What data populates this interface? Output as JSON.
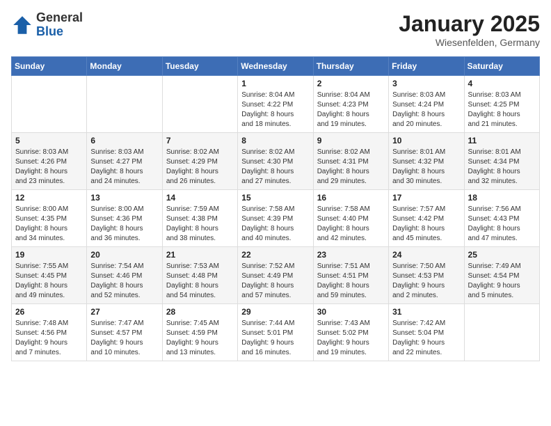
{
  "header": {
    "logo_general": "General",
    "logo_blue": "Blue",
    "month_title": "January 2025",
    "location": "Wiesenfelden, Germany"
  },
  "weekdays": [
    "Sunday",
    "Monday",
    "Tuesday",
    "Wednesday",
    "Thursday",
    "Friday",
    "Saturday"
  ],
  "weeks": [
    [
      {
        "day": "",
        "info": ""
      },
      {
        "day": "",
        "info": ""
      },
      {
        "day": "",
        "info": ""
      },
      {
        "day": "1",
        "info": "Sunrise: 8:04 AM\nSunset: 4:22 PM\nDaylight: 8 hours\nand 18 minutes."
      },
      {
        "day": "2",
        "info": "Sunrise: 8:04 AM\nSunset: 4:23 PM\nDaylight: 8 hours\nand 19 minutes."
      },
      {
        "day": "3",
        "info": "Sunrise: 8:03 AM\nSunset: 4:24 PM\nDaylight: 8 hours\nand 20 minutes."
      },
      {
        "day": "4",
        "info": "Sunrise: 8:03 AM\nSunset: 4:25 PM\nDaylight: 8 hours\nand 21 minutes."
      }
    ],
    [
      {
        "day": "5",
        "info": "Sunrise: 8:03 AM\nSunset: 4:26 PM\nDaylight: 8 hours\nand 23 minutes."
      },
      {
        "day": "6",
        "info": "Sunrise: 8:03 AM\nSunset: 4:27 PM\nDaylight: 8 hours\nand 24 minutes."
      },
      {
        "day": "7",
        "info": "Sunrise: 8:02 AM\nSunset: 4:29 PM\nDaylight: 8 hours\nand 26 minutes."
      },
      {
        "day": "8",
        "info": "Sunrise: 8:02 AM\nSunset: 4:30 PM\nDaylight: 8 hours\nand 27 minutes."
      },
      {
        "day": "9",
        "info": "Sunrise: 8:02 AM\nSunset: 4:31 PM\nDaylight: 8 hours\nand 29 minutes."
      },
      {
        "day": "10",
        "info": "Sunrise: 8:01 AM\nSunset: 4:32 PM\nDaylight: 8 hours\nand 30 minutes."
      },
      {
        "day": "11",
        "info": "Sunrise: 8:01 AM\nSunset: 4:34 PM\nDaylight: 8 hours\nand 32 minutes."
      }
    ],
    [
      {
        "day": "12",
        "info": "Sunrise: 8:00 AM\nSunset: 4:35 PM\nDaylight: 8 hours\nand 34 minutes."
      },
      {
        "day": "13",
        "info": "Sunrise: 8:00 AM\nSunset: 4:36 PM\nDaylight: 8 hours\nand 36 minutes."
      },
      {
        "day": "14",
        "info": "Sunrise: 7:59 AM\nSunset: 4:38 PM\nDaylight: 8 hours\nand 38 minutes."
      },
      {
        "day": "15",
        "info": "Sunrise: 7:58 AM\nSunset: 4:39 PM\nDaylight: 8 hours\nand 40 minutes."
      },
      {
        "day": "16",
        "info": "Sunrise: 7:58 AM\nSunset: 4:40 PM\nDaylight: 8 hours\nand 42 minutes."
      },
      {
        "day": "17",
        "info": "Sunrise: 7:57 AM\nSunset: 4:42 PM\nDaylight: 8 hours\nand 45 minutes."
      },
      {
        "day": "18",
        "info": "Sunrise: 7:56 AM\nSunset: 4:43 PM\nDaylight: 8 hours\nand 47 minutes."
      }
    ],
    [
      {
        "day": "19",
        "info": "Sunrise: 7:55 AM\nSunset: 4:45 PM\nDaylight: 8 hours\nand 49 minutes."
      },
      {
        "day": "20",
        "info": "Sunrise: 7:54 AM\nSunset: 4:46 PM\nDaylight: 8 hours\nand 52 minutes."
      },
      {
        "day": "21",
        "info": "Sunrise: 7:53 AM\nSunset: 4:48 PM\nDaylight: 8 hours\nand 54 minutes."
      },
      {
        "day": "22",
        "info": "Sunrise: 7:52 AM\nSunset: 4:49 PM\nDaylight: 8 hours\nand 57 minutes."
      },
      {
        "day": "23",
        "info": "Sunrise: 7:51 AM\nSunset: 4:51 PM\nDaylight: 8 hours\nand 59 minutes."
      },
      {
        "day": "24",
        "info": "Sunrise: 7:50 AM\nSunset: 4:53 PM\nDaylight: 9 hours\nand 2 minutes."
      },
      {
        "day": "25",
        "info": "Sunrise: 7:49 AM\nSunset: 4:54 PM\nDaylight: 9 hours\nand 5 minutes."
      }
    ],
    [
      {
        "day": "26",
        "info": "Sunrise: 7:48 AM\nSunset: 4:56 PM\nDaylight: 9 hours\nand 7 minutes."
      },
      {
        "day": "27",
        "info": "Sunrise: 7:47 AM\nSunset: 4:57 PM\nDaylight: 9 hours\nand 10 minutes."
      },
      {
        "day": "28",
        "info": "Sunrise: 7:45 AM\nSunset: 4:59 PM\nDaylight: 9 hours\nand 13 minutes."
      },
      {
        "day": "29",
        "info": "Sunrise: 7:44 AM\nSunset: 5:01 PM\nDaylight: 9 hours\nand 16 minutes."
      },
      {
        "day": "30",
        "info": "Sunrise: 7:43 AM\nSunset: 5:02 PM\nDaylight: 9 hours\nand 19 minutes."
      },
      {
        "day": "31",
        "info": "Sunrise: 7:42 AM\nSunset: 5:04 PM\nDaylight: 9 hours\nand 22 minutes."
      },
      {
        "day": "",
        "info": ""
      }
    ]
  ]
}
